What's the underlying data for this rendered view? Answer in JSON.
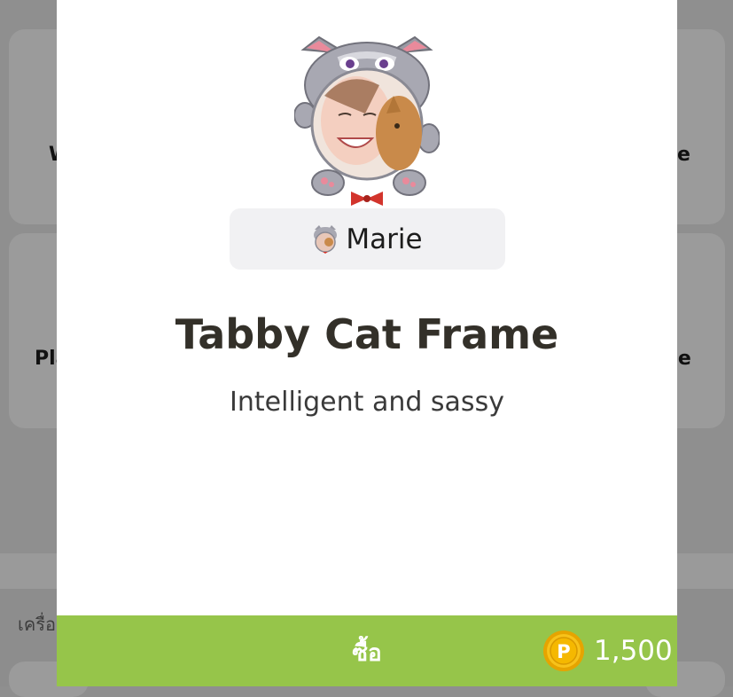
{
  "background": {
    "cards": [
      {
        "label_left": "W",
        "label_right": "e"
      },
      {
        "label_left": "Pla",
        "label_right": "me"
      }
    ],
    "section_label": "เครื่อ"
  },
  "modal": {
    "frame_icon": "tabby-cat-frame-icon",
    "preview_user": {
      "name": "Marie"
    },
    "title": "Tabby Cat Frame",
    "description": "Intelligent and sassy",
    "buy": {
      "label": "ซื้อ",
      "price": "1,500",
      "coin_icon": "point-coin-icon",
      "coin_letter": "P"
    }
  },
  "colors": {
    "buy_bar": "#96c54a",
    "coin": "#f2b705",
    "title": "#333029",
    "overlay": "#8f8f8f"
  }
}
